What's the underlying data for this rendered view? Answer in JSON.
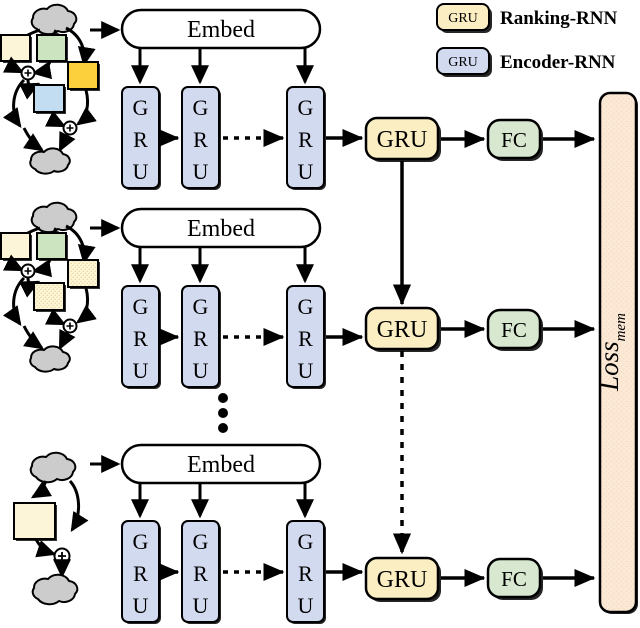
{
  "figure": {
    "type": "diagram",
    "title": "Hierarchical RNN architecture with Encoder-RNN and Ranking-RNN"
  },
  "legend": {
    "items": [
      {
        "box_label": "GRU",
        "label": "Ranking-RNN",
        "color": "#fbeec2"
      },
      {
        "box_label": "GRU",
        "label": "Encoder-RNN",
        "color": "#d2daf0"
      }
    ]
  },
  "colors": {
    "ranking_gru": "#fbeec2",
    "encoder_gru": "#d2daf0",
    "fc": "#d8e8d0",
    "loss": "#fae4d2",
    "embed": "#ffffff",
    "cloud": "#cccccc",
    "graph_cream": "#fdf5d8",
    "graph_green": "#cce5c0",
    "graph_yellow": "#fccf3c",
    "graph_blue": "#c2dcf2",
    "stroke": "#000000"
  },
  "rows": [
    {
      "id": "row-1",
      "embed_label": "Embed",
      "encoder_cells": [
        "GRU",
        "GRU",
        "GRU"
      ],
      "ranking_label": "GRU",
      "fc_label": "FC",
      "graph": {
        "id": "graph-1",
        "top_cloud": "cloud",
        "bottom_cloud": "cloud",
        "nodes": [
          "cream",
          "green",
          "yellow",
          "blue"
        ],
        "operators": [
          "+",
          "+"
        ]
      }
    },
    {
      "id": "row-2",
      "embed_label": "Embed",
      "encoder_cells": [
        "GRU",
        "GRU",
        "GRU"
      ],
      "ranking_label": "GRU",
      "fc_label": "FC",
      "graph": {
        "id": "graph-2",
        "top_cloud": "cloud",
        "bottom_cloud": "cloud",
        "nodes": [
          "cream",
          "green",
          "dotted",
          "dotted"
        ],
        "operators": [
          "+",
          "+"
        ]
      }
    },
    {
      "id": "row-3",
      "embed_label": "Embed",
      "encoder_cells": [
        "GRU",
        "GRU",
        "GRU"
      ],
      "ranking_label": "GRU",
      "fc_label": "FC",
      "graph": {
        "id": "graph-3",
        "top_cloud": "cloud",
        "bottom_cloud": "cloud",
        "nodes": [
          "cream"
        ],
        "operators": [
          "+"
        ]
      }
    }
  ],
  "ellipsis": {
    "glyph": "•",
    "count": 3
  },
  "loss": {
    "label": "Loss",
    "subscript": "mem"
  },
  "edges": {
    "encoder_chain_style": [
      "solid",
      "dashed"
    ],
    "ranking_chain_style": [
      "solid",
      "dashed"
    ]
  }
}
